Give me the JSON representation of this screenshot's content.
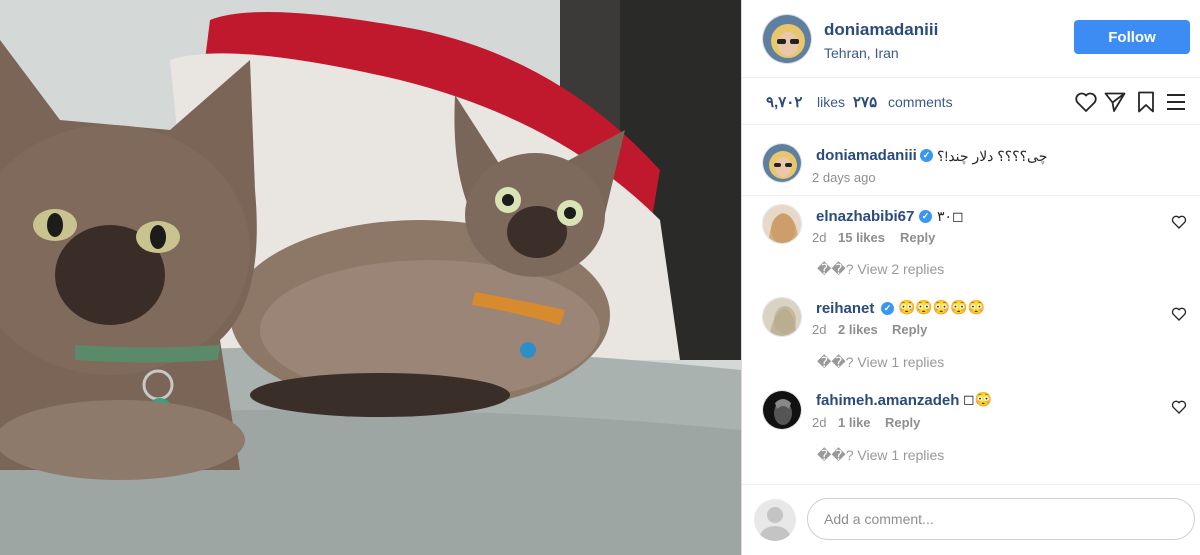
{
  "post": {
    "photo_alt": "",
    "author": {
      "username": "doniamadaniii",
      "location": "Tehran, Iran"
    },
    "follow_label": "Follow",
    "likes_count": "۹,۷۰۲",
    "likes_label": "likes",
    "comments_count": "۲۷۵",
    "comments_label": "comments",
    "icons": [
      "heart-icon",
      "share-icon",
      "bookmark-icon",
      "menu-icon"
    ]
  },
  "caption": {
    "username": "doniamadaniii",
    "text": "چی؟؟؟؟ دلار چند!؟",
    "time": "2 days ago"
  },
  "comments": [
    {
      "username": "elnazhabibi67",
      "verified": true,
      "text": "۳۰◻",
      "age": "2d",
      "likes": "15 likes",
      "reply_label": "Reply",
      "view_replies": "��? View 2 replies"
    },
    {
      "username": "reihanet",
      "verified": true,
      "text": "😳😳😳😳😳",
      "age": "2d",
      "likes": "2 likes",
      "reply_label": "Reply",
      "view_replies": "��? View 1 replies"
    },
    {
      "username": "fahimeh.amanzadeh",
      "verified": false,
      "text": "◻😳",
      "age": "2d",
      "likes": "1 like",
      "reply_label": "Reply",
      "view_replies": "��? View 1 replies"
    }
  ],
  "add_comment": {
    "placeholder": "Add a comment..."
  },
  "colors": {
    "follow_button": "#3c8cf4",
    "username": "#2a4b7c",
    "verified": "#3897f0"
  }
}
